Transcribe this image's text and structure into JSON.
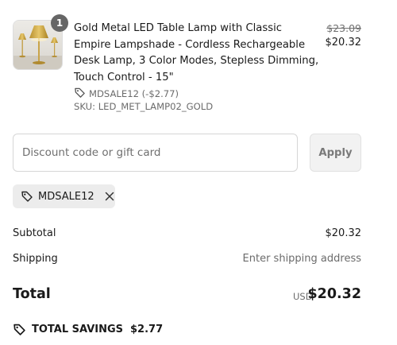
{
  "line_item": {
    "quantity": "1",
    "title": "Gold Metal LED Table Lamp with Classic Empire Lampshade - Cordless Rechargeable Desk Lamp, 3 Color Modes, Stepless Dimming, Touch Control - 15\"",
    "price_original": "$23.09",
    "price_current": "$20.32",
    "discount_text": "MDSALE12 (-$2.77)",
    "sku": "SKU: LED_MET_LAMP02_GOLD",
    "image_icon": "lamp-product-image"
  },
  "discount": {
    "placeholder": "Discount code or gift card",
    "value": "",
    "apply_label": "Apply",
    "applied_code": "MDSALE12"
  },
  "summary": {
    "subtotal_label": "Subtotal",
    "subtotal_value": "$20.32",
    "shipping_label": "Shipping",
    "shipping_value": "Enter shipping address",
    "total_label": "Total",
    "total_currency": "USD",
    "total_value": "$20.32",
    "savings_label": "TOTAL SAVINGS",
    "savings_value": "$2.77"
  },
  "colors": {
    "badge": "#666666",
    "apply_bg": "#f2f2f2",
    "chip_bg": "#ececec",
    "muted_text": "#6b6b6b"
  }
}
